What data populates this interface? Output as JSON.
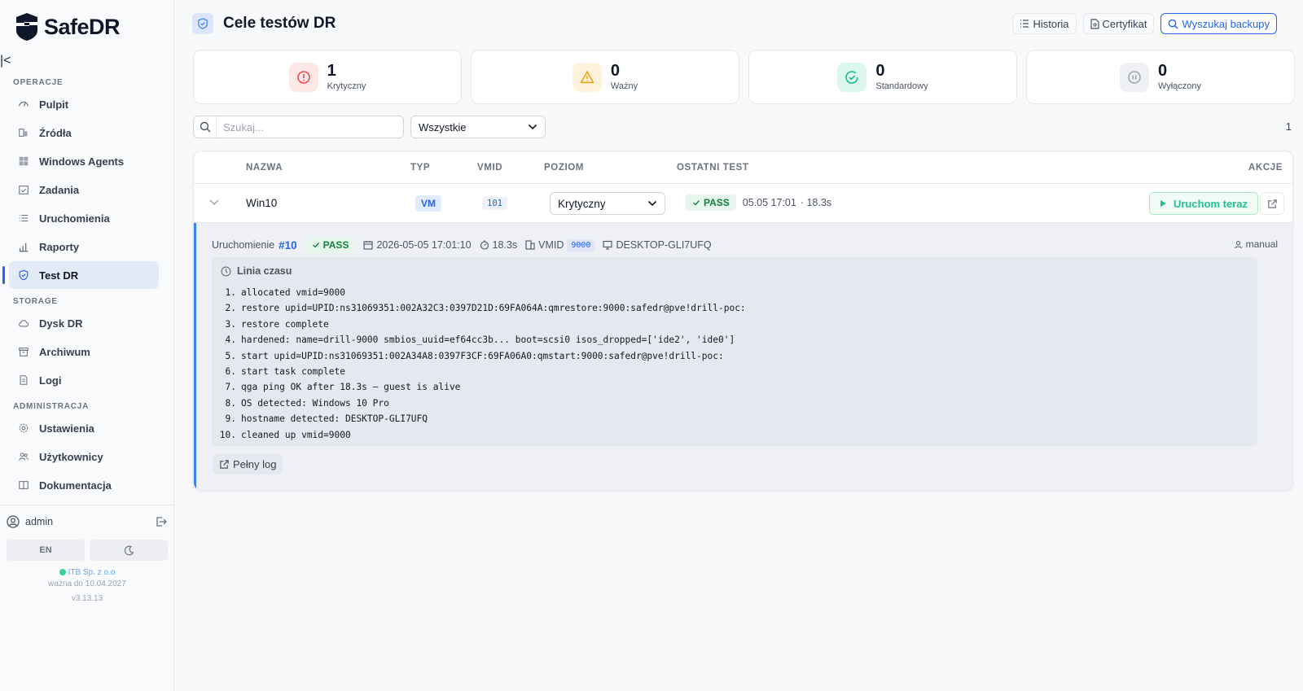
{
  "app": {
    "name": "SafeDR"
  },
  "sidebar": {
    "sections": [
      {
        "label": "OPERACJE",
        "items": [
          {
            "label": "Pulpit",
            "icon": "dashboard-icon"
          },
          {
            "label": "Źródła",
            "icon": "sources-icon"
          },
          {
            "label": "Windows Agents",
            "icon": "windows-icon"
          },
          {
            "label": "Zadania",
            "icon": "calendar-check-icon"
          },
          {
            "label": "Uruchomienia",
            "icon": "list-icon"
          },
          {
            "label": "Raporty",
            "icon": "bar-chart-icon"
          },
          {
            "label": "Test DR",
            "icon": "shield-check-icon",
            "active": true
          }
        ]
      },
      {
        "label": "STORAGE",
        "items": [
          {
            "label": "Dysk DR",
            "icon": "cloud-icon"
          },
          {
            "label": "Archiwum",
            "icon": "archive-icon"
          },
          {
            "label": "Logi",
            "icon": "file-icon"
          }
        ]
      },
      {
        "label": "ADMINISTRACJA",
        "items": [
          {
            "label": "Ustawienia",
            "icon": "gear-icon"
          },
          {
            "label": "Użytkownicy",
            "icon": "users-icon"
          },
          {
            "label": "Dokumentacja",
            "icon": "book-icon"
          }
        ]
      }
    ],
    "user": "admin",
    "lang": "EN",
    "license_org": "ITB Sp. z o.o",
    "license_valid": "ważna do 10.04.2027",
    "version": "v3.13.13"
  },
  "header": {
    "title": "Cele testów DR",
    "actions": {
      "history": "Historia",
      "certificate": "Certyfikat",
      "search_backups": "Wyszukaj backupy"
    }
  },
  "stats": [
    {
      "value": "1",
      "label": "Krytyczny",
      "color": "#ef4444",
      "bg": "#fde8e8"
    },
    {
      "value": "0",
      "label": "Ważny",
      "color": "#f59e0b",
      "bg": "#fef3dc"
    },
    {
      "value": "0",
      "label": "Standardowy",
      "color": "#10b981",
      "bg": "#dcf7ec"
    },
    {
      "value": "0",
      "label": "Wyłączony",
      "color": "#9ca3af",
      "bg": "#eef0f3"
    }
  ],
  "filters": {
    "search_placeholder": "Szukaj...",
    "filter_value": "Wszystkie",
    "count": "1"
  },
  "table": {
    "columns": {
      "name": "NAZWA",
      "type": "TYP",
      "vmid": "VMID",
      "level": "POZIOM",
      "last_test": "OSTATNI TEST",
      "actions": "AKCJE"
    },
    "row": {
      "name": "Win10",
      "type": "VM",
      "vmid": "101",
      "level": "Krytyczny",
      "status": "PASS",
      "last_date": "05.05 17:01",
      "duration": "· 18.3s",
      "run_label": "Uruchom teraz"
    }
  },
  "detail": {
    "run_label": "Uruchomienie",
    "run_number": "#10",
    "status": "PASS",
    "timestamp": "2026-05-05 17:01:10",
    "duration": "18.3s",
    "vmid_label": "VMID",
    "vmid": "9000",
    "host": "DESKTOP-GLI7UFQ",
    "trigger": "manual",
    "timeline_title": "Linia czasu",
    "timeline": [
      "allocated vmid=9000",
      "restore upid=UPID:ns31069351:002A32C3:0397D21D:69FA064A:qmrestore:9000:safedr@pve!drill-poc:",
      "restore complete",
      "hardened: name=drill-9000 smbios_uuid=ef64cc3b... boot=scsi0 isos_dropped=['ide2', 'ide0']",
      "start upid=UPID:ns31069351:002A34A8:0397F3CF:69FA06A0:qmstart:9000:safedr@pve!drill-poc:",
      "start task complete",
      "qga ping OK after 18.3s — guest is alive",
      "OS detected: Windows 10 Pro",
      "hostname detected: DESKTOP-GLI7UFQ",
      "cleaned up vmid=9000"
    ],
    "full_log": "Pełny log"
  }
}
